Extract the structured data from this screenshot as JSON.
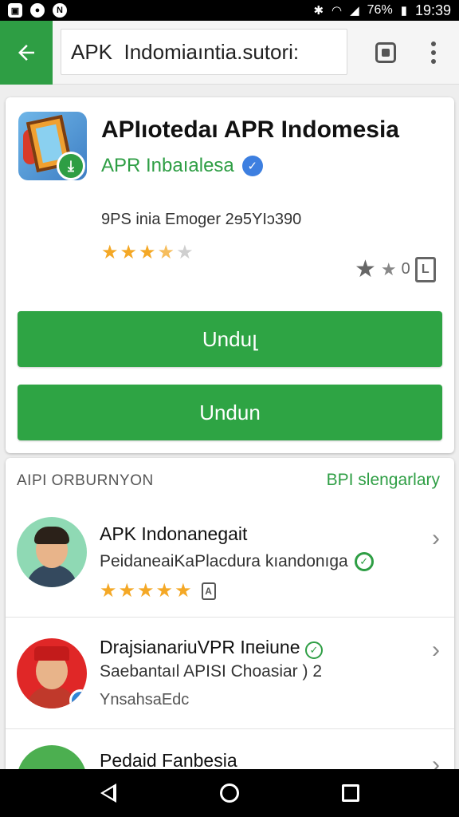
{
  "status_bar": {
    "left_icons": [
      "gallery-icon",
      "chat-icon",
      "n-icon"
    ],
    "right_icons": [
      "bluetooth-icon",
      "wifi-icon",
      "signal-icon"
    ],
    "battery": "76%",
    "time": "19:39"
  },
  "appbar": {
    "search_value": "APK  Indomiaıntia.sutori:",
    "accent": "#2e9e44"
  },
  "app": {
    "title": "APIıotedaı APR Indomesia",
    "developer": "APR Inbaıalesa",
    "meta": "9PS inia Emoger 2ɘ5YIɔ390",
    "rating": 3.5,
    "rating_count": "0",
    "doc_tag": "L",
    "button_1": "Unduլ",
    "button_2": "Undun"
  },
  "list": {
    "header": "AIPI ORBURNYON",
    "more_link": "BPI slengarlary",
    "items": [
      {
        "title": "APK Indonanegait",
        "subtitle": "PeidaneaiKaPlacdura kıandonıga",
        "rating": 5,
        "tag": "A"
      },
      {
        "title": "DrajsianariuVPR Iпeiune",
        "subtitle": "Saebantaıl APISI Choasiar ) 2",
        "extra": "YnsahsaEdc"
      },
      {
        "title": "Pedaid Fanbesia"
      }
    ]
  }
}
